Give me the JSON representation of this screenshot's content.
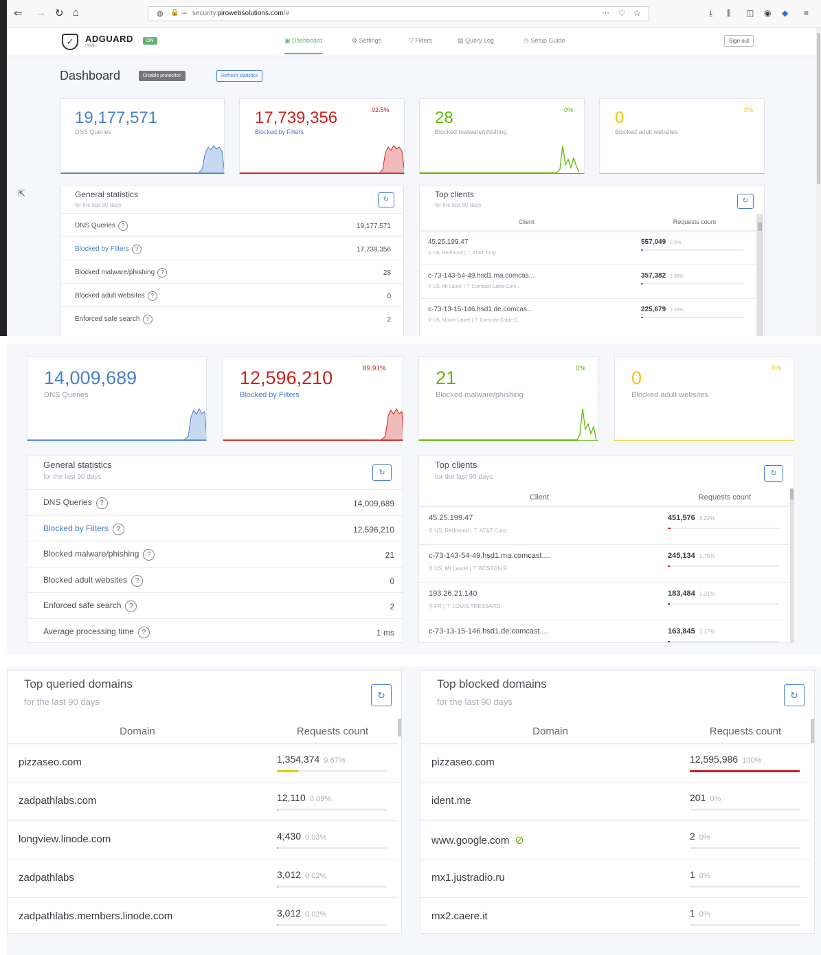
{
  "browser": {
    "url_prefix": "security.",
    "url_domain": "pirowebsolutions.com",
    "url_suffix": "/#"
  },
  "app": {
    "logo": "ADGUARD",
    "logo_sub": "HOME",
    "status_badge": "ON",
    "nav": [
      "Dashboard",
      "Settings",
      "Filters",
      "Query Log",
      "Setup Guide"
    ],
    "sign_out": "Sign out",
    "page_title": "Dashboard",
    "disable_btn": "Disable protection",
    "refresh_btn": "Refresh statistics"
  },
  "s1": {
    "cards": [
      {
        "value": "19,177,571",
        "label": "DNS Queries",
        "pct": ""
      },
      {
        "value": "17,739,356",
        "label": "Blocked by Filters",
        "pct": "92.5%"
      },
      {
        "value": "28",
        "label": "Blocked malware/phishing",
        "pct": "0%"
      },
      {
        "value": "0",
        "label": "Blocked adult websites",
        "pct": "0%"
      }
    ],
    "general": {
      "title": "General statistics",
      "subtitle": "for the last 90 days",
      "rows": [
        {
          "label": "DNS Queries",
          "value": "19,177,571"
        },
        {
          "label": "Blocked by Filters",
          "value": "17,739,356"
        },
        {
          "label": "Blocked malware/phishing",
          "value": "28"
        },
        {
          "label": "Blocked adult websites",
          "value": "0"
        },
        {
          "label": "Enforced safe search",
          "value": "2"
        }
      ]
    },
    "clients": {
      "title": "Top clients",
      "subtitle": "for the last 90 days",
      "col_client": "Client",
      "col_count": "Requests count",
      "rows": [
        {
          "name": "45.25.199.47",
          "loc": "US, Redmond",
          "org": "AT&T Corp.",
          "count": "557,049",
          "pct": "2.9%",
          "share": 0.029
        },
        {
          "name": "c-73-143-54-49.hsd1.ma.comcas...",
          "loc": "US, Mt Laurel",
          "org": "Comcast Cable Com...",
          "count": "357,382",
          "pct": "1.86%",
          "share": 0.0186
        },
        {
          "name": "c-73-13-15-146.hsd1.de.comcas...",
          "loc": "US, Mount Laurel",
          "org": "Comcast Cable C...",
          "count": "225,679",
          "pct": "1.18%",
          "share": 0.0118
        }
      ]
    }
  },
  "s2": {
    "cards": [
      {
        "value": "14,009,689",
        "label": "DNS Queries",
        "pct": ""
      },
      {
        "value": "12,596,210",
        "label": "Blocked by Filters",
        "pct": "89.91%"
      },
      {
        "value": "21",
        "label": "Blocked malware/phishing",
        "pct": "0%"
      },
      {
        "value": "0",
        "label": "Blocked adult websites",
        "pct": "0%"
      }
    ],
    "general": {
      "title": "General statistics",
      "subtitle": "for the last 90 days",
      "rows": [
        {
          "label": "DNS Queries",
          "value": "14,009,689"
        },
        {
          "label": "Blocked by Filters",
          "value": "12,596,210"
        },
        {
          "label": "Blocked malware/phishing",
          "value": "21"
        },
        {
          "label": "Blocked adult websites",
          "value": "0"
        },
        {
          "label": "Enforced safe search",
          "value": "2"
        },
        {
          "label": "Average processing time",
          "value": "1 ms"
        }
      ]
    },
    "clients": {
      "title": "Top clients",
      "subtitle": "for the last 90 days",
      "col_client": "Client",
      "col_count": "Requests count",
      "rows": [
        {
          "name": "45.25.199.47",
          "loc": "US, Redmond",
          "org": "AT&T Corp.",
          "count": "451,576",
          "pct": "3.22%",
          "share": 0.0322
        },
        {
          "name": "c-73-143-54-49.hsd1.ma.comcast....",
          "loc": "US, Mt Laurel",
          "org": "BOSTON 9",
          "count": "245,134",
          "pct": "1.75%",
          "share": 0.0175
        },
        {
          "name": "193.26.21.140",
          "loc": "FR",
          "org": "LOUIS TRESSARD",
          "count": "183,484",
          "pct": "1.31%",
          "share": 0.0131
        },
        {
          "name": "c-73-13-15-146.hsd1.de.comcast....",
          "loc": "",
          "org": "",
          "count": "163,845",
          "pct": "1.17%",
          "share": 0.0117
        }
      ]
    }
  },
  "s3": {
    "queried": {
      "title": "Top queried domains",
      "subtitle": "for the last 90 days",
      "col_domain": "Domain",
      "col_count": "Requests count",
      "rows": [
        {
          "domain": "pizzaseo.com",
          "count": "1,354,374",
          "pct": "9.67%",
          "share": 0.0967
        },
        {
          "domain": "zadpathlabs.com",
          "count": "12,110",
          "pct": "0.09%",
          "share": 0.0009
        },
        {
          "domain": "longview.linode.com",
          "count": "4,430",
          "pct": "0.03%",
          "share": 0.0003
        },
        {
          "domain": "zadpathlabs",
          "count": "3,012",
          "pct": "0.02%",
          "share": 0.0002
        },
        {
          "domain": "zadpathlabs.members.linode.com",
          "count": "3,012",
          "pct": "0.02%",
          "share": 0.0002
        }
      ]
    },
    "blocked": {
      "title": "Top blocked domains",
      "subtitle": "for the last 90 days",
      "col_domain": "Domain",
      "col_count": "Requests count",
      "rows": [
        {
          "domain": "pizzaseo.com",
          "count": "12,595,986",
          "pct": "100%",
          "share": 1.0
        },
        {
          "domain": "ident.me",
          "count": "201",
          "pct": "0%",
          "share": 0
        },
        {
          "domain": "www.google.com",
          "count": "2",
          "pct": "0%",
          "share": 0
        },
        {
          "domain": "mx1.justradio.ru",
          "count": "1",
          "pct": "0%",
          "share": 0
        },
        {
          "domain": "mx2.caere.it",
          "count": "1",
          "pct": "0%",
          "share": 0
        }
      ]
    }
  },
  "colors": {
    "blue": "#467fcf",
    "red": "#cd201f",
    "green": "#5eba00",
    "yellow": "#f1c40f",
    "brand_green": "#67b279"
  }
}
